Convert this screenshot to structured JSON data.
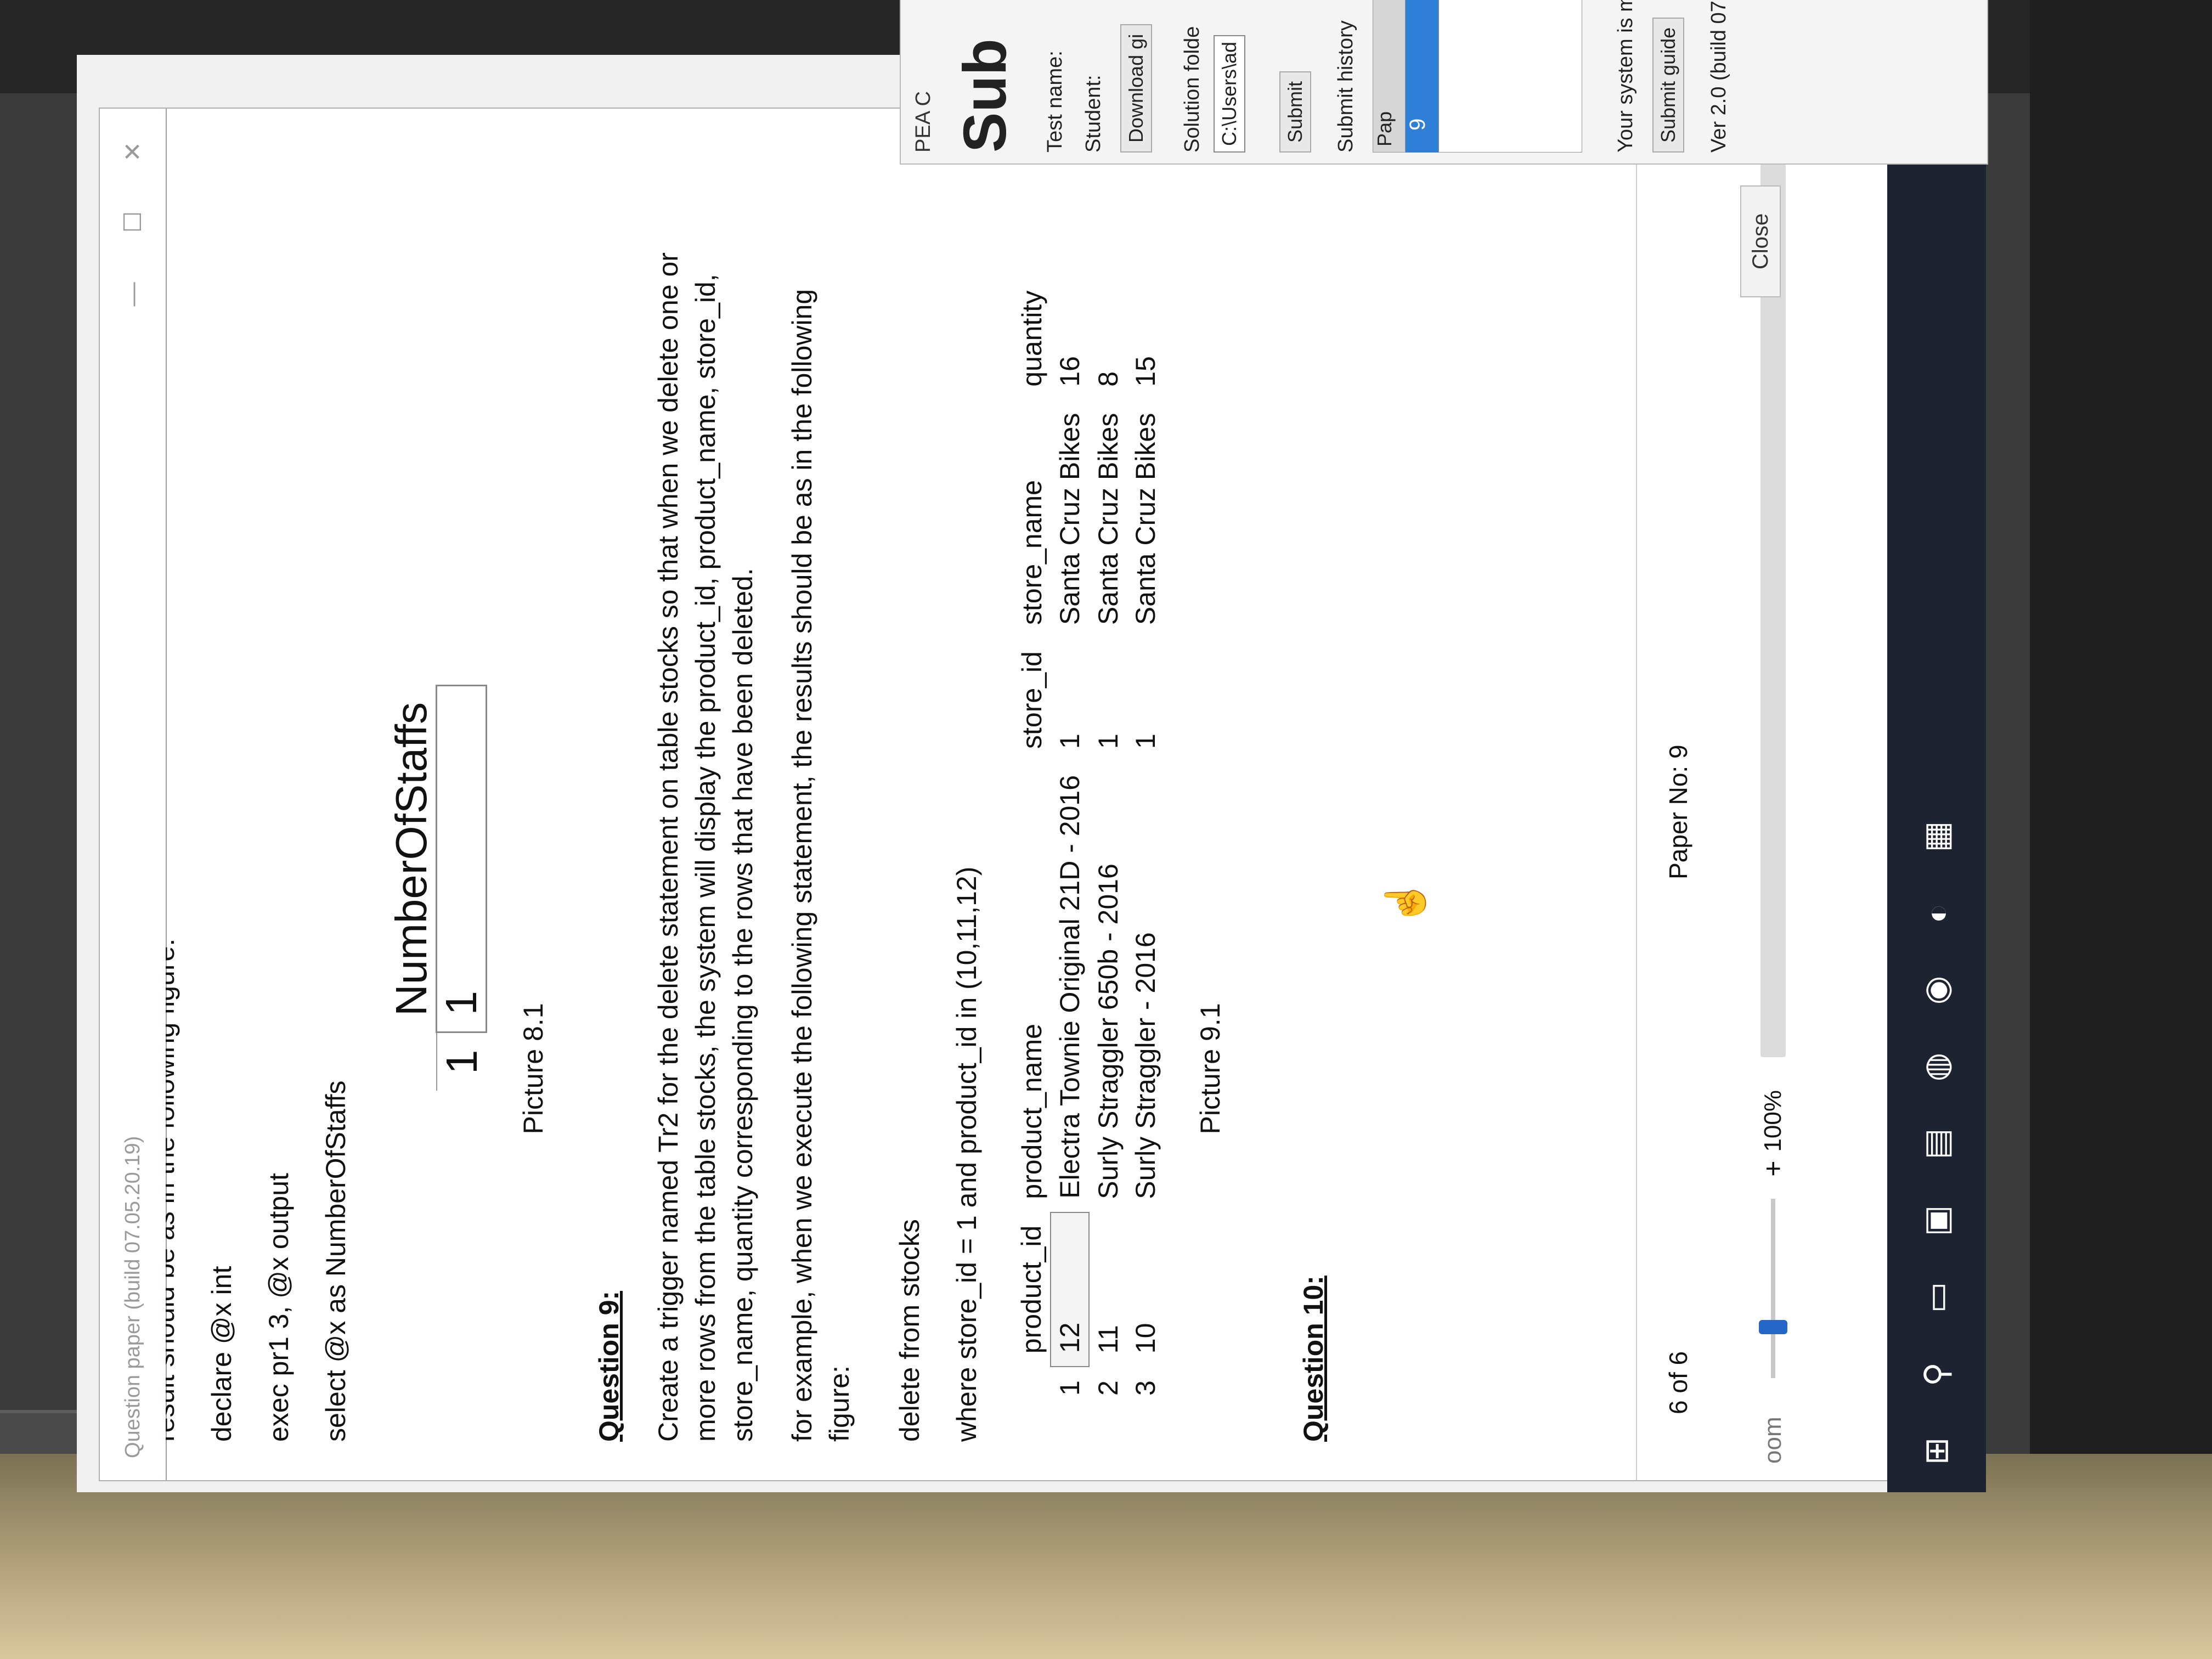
{
  "window": {
    "title": "Question paper (build 07.05.20.19)",
    "minimize": "—",
    "maximize": "☐",
    "close": "✕"
  },
  "document": {
    "clipped_line": "result should be as in the following figure:",
    "code_q8": [
      "declare @x int",
      "exec pr1 3, @x output",
      "select @x as NumberOfStaffs"
    ],
    "picture81": {
      "column": "NumberOfStaffs",
      "row_number": "1",
      "value": "1",
      "caption": "Picture 8.1"
    },
    "question9": {
      "heading": "Question 9:",
      "text": "Create a trigger named Tr2 for the delete statement on table stocks so that when we delete one or more rows from the table stocks, the system will display the product_id, product_name, store_id, store_name, quantity corresponding to the rows that have been deleted.",
      "example": "for example, when we execute the following statement, the results should be as in the following figure:",
      "code": [
        "delete from stocks",
        "where store_id = 1 and product_id in (10,11,12)"
      ]
    },
    "picture91": {
      "columns": [
        "product_id",
        "product_name",
        "store_id",
        "store_name",
        "quantity"
      ],
      "rows": [
        {
          "n": "1",
          "product_id": "12",
          "product_name": "Electra Townie Original 21D - 2016",
          "store_id": "1",
          "store_name": "Santa Cruz Bikes",
          "quantity": "16"
        },
        {
          "n": "2",
          "product_id": "11",
          "product_name": "Surly Straggler 650b - 2016",
          "store_id": "1",
          "store_name": "Santa Cruz Bikes",
          "quantity": "8"
        },
        {
          "n": "3",
          "product_id": "10",
          "product_name": "Surly Straggler - 2016",
          "store_id": "1",
          "store_name": "Santa Cruz Bikes",
          "quantity": "15"
        }
      ],
      "caption": "Picture 9.1"
    },
    "question10": {
      "heading": "Question 10:"
    }
  },
  "footer": {
    "page_info": "6 of 6",
    "paper_no": "Paper No: 9"
  },
  "zoom": {
    "label": "oom",
    "plus": "+",
    "value": "100%",
    "close_label": "Close",
    "arrows": "‹ ›"
  },
  "panel": {
    "header": "PEA C",
    "title": "Sub",
    "test_name_label": "Test name:",
    "student_label": "Student:",
    "download_label": "Download gi",
    "solution_label": "Solution folde",
    "solution_path": "C:\\Users\\ad",
    "submit_label": "Submit",
    "submit_history_label": "Submit history",
    "list_header": "Pap",
    "list_selected": "9",
    "system_note": "Your system is m",
    "submit_guide": "Submit guide",
    "version": "Ver 2.0 (build 07"
  },
  "taskbar": {
    "icons": [
      "windows-start-icon",
      "search-icon",
      "task-view-icon",
      "store-icon",
      "file-explorer-icon",
      "edge-icon",
      "chrome-icon",
      "firefox-icon",
      "app-icon"
    ]
  }
}
